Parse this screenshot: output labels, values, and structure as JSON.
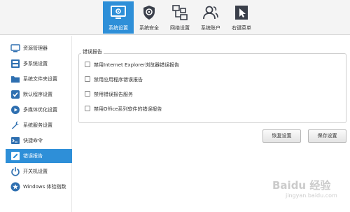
{
  "toolbar": {
    "tabs": [
      {
        "label": "系统设置",
        "icon": "monitor-gear-icon"
      },
      {
        "label": "系统安全",
        "icon": "shield-gear-icon"
      },
      {
        "label": "网络设置",
        "icon": "network-icon"
      },
      {
        "label": "系统账户",
        "icon": "users-icon"
      },
      {
        "label": "右键菜单",
        "icon": "cursor-menu-icon"
      }
    ]
  },
  "sidebar": {
    "items": [
      {
        "label": "资源管理器"
      },
      {
        "label": "多系统设置"
      },
      {
        "label": "系统文件夹设置"
      },
      {
        "label": "默认程序设置"
      },
      {
        "label": "多媒体优化设置"
      },
      {
        "label": "系统服务设置"
      },
      {
        "label": "快捷命令"
      },
      {
        "label": "错误报告"
      },
      {
        "label": "开关机设置"
      },
      {
        "label": "Windows 体验指数"
      }
    ]
  },
  "main": {
    "group_title": "错误报告",
    "options": [
      {
        "label": "禁用Internet Explorer浏览器错误报告",
        "checked": false
      },
      {
        "label": "禁用应用程序错误报告",
        "checked": false
      },
      {
        "label": "禁用错误报告服务",
        "checked": false
      },
      {
        "label": "禁用Office系列软件的错误报告",
        "checked": false
      }
    ],
    "restore_label": "恢复设置",
    "save_label": "保存设置"
  },
  "watermark": {
    "brand": "Baidu 经验",
    "url": "jingyan.baidu.com"
  },
  "colors": {
    "accent": "#2e8fd8",
    "toolbar_bg": "#f4f4f4",
    "icon_dark": "#3a3f4a"
  }
}
